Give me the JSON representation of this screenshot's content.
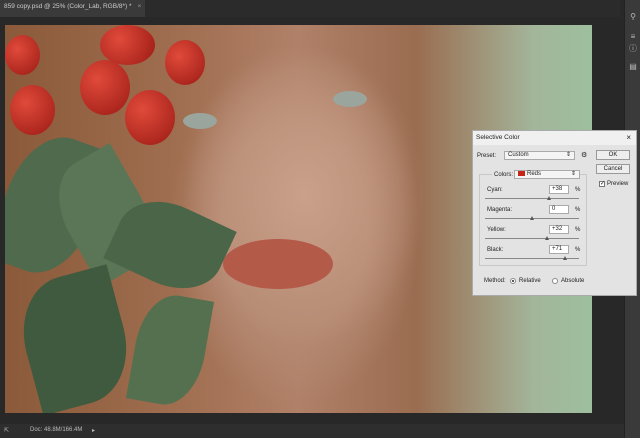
{
  "document_tab": {
    "title": "859 copy.psd @ 25% (Color_Lab, RGB/8*) *",
    "close": "×"
  },
  "status": {
    "doc_size": "Doc: 48.8M/166.4M"
  },
  "dialog": {
    "title": "Selective Color",
    "close": "×",
    "preset_label": "Preset:",
    "preset_value": "Custom",
    "ok_label": "OK",
    "cancel_label": "Cancel",
    "preview_label": "Preview",
    "preview_checked": true,
    "colors_label": "Colors:",
    "colors_value": "Reds",
    "colors_swatch": "#c8251a",
    "sliders": [
      {
        "label": "Cyan:",
        "value": "+38",
        "unit": "%",
        "percent": 38
      },
      {
        "label": "Magenta:",
        "value": "0",
        "unit": "%",
        "percent": 0
      },
      {
        "label": "Yellow:",
        "value": "+32",
        "unit": "%",
        "percent": 32
      },
      {
        "label": "Black:",
        "value": "+71",
        "unit": "%",
        "percent": 71
      }
    ],
    "method_label": "Method:",
    "method_options": [
      "Relative",
      "Absolute"
    ],
    "method_selected": "Relative"
  }
}
